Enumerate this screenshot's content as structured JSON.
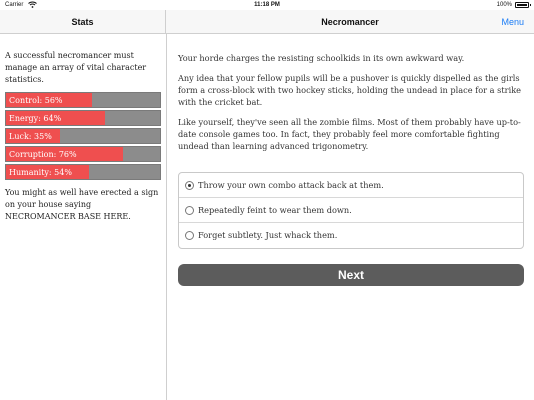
{
  "status_bar": {
    "carrier": "Carrier",
    "time": "11:18 PM",
    "battery": "100%",
    "wifi_icon": "wifi-icon",
    "battery_icon": "battery-icon"
  },
  "stats_panel": {
    "title": "Stats",
    "intro": "A successful necromancer must manage an array of vital character statistics.",
    "bars": [
      {
        "label": "Control: 56%",
        "value": 56
      },
      {
        "label": "Energy: 64%",
        "value": 64
      },
      {
        "label": "Luck: 35%",
        "value": 35
      },
      {
        "label": "Corruption: 76%",
        "value": 76
      },
      {
        "label": "Humanity: 54%",
        "value": 54
      }
    ],
    "outro": "You might as well have erected a sign on your house saying NECROMANCER BASE HERE."
  },
  "main": {
    "title": "Necromancer",
    "menu_label": "Menu",
    "paragraphs": [
      "Your horde charges the resisting schoolkids in its own awkward way.",
      "Any idea that your fellow pupils will be a pushover is quickly dispelled as the girls form a cross-block with two hockey sticks, holding the undead in place for a strike with the cricket bat.",
      "Like yourself, they've seen all the zombie films. Most of them probably have up-to-date console games too. In fact, they probably feel more comfortable fighting undead than learning advanced trigonometry."
    ],
    "choices": [
      {
        "label": "Throw your own combo attack back at them.",
        "selected": true
      },
      {
        "label": "Repeatedly feint to wear them down.",
        "selected": false
      },
      {
        "label": "Forget subtlety. Just whack them.",
        "selected": false
      }
    ],
    "next_label": "Next"
  },
  "colors": {
    "bar_fill": "#ef4f4f",
    "bar_track": "#8c8c8c",
    "accent": "#1a7cf6",
    "button": "#5c5c5c"
  }
}
